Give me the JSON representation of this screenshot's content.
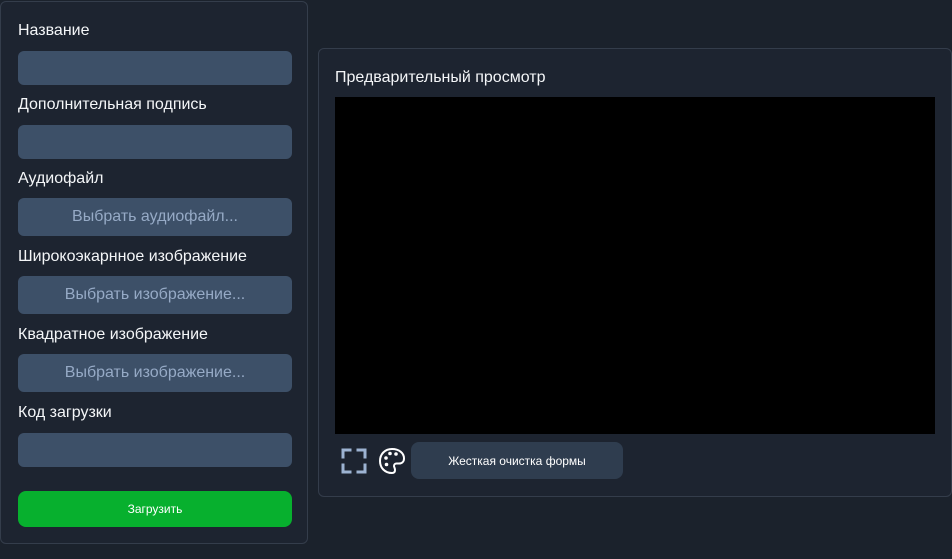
{
  "form": {
    "title_label": "Название",
    "title_value": "",
    "subtitle_label": "Дополнительная подпись",
    "subtitle_value": "",
    "audio_label": "Аудиофайл",
    "audio_button": "Выбрать аудиофайл...",
    "wide_image_label": "Широкоэкарнное изображение",
    "wide_image_button": "Выбрать изображение...",
    "square_image_label": "Квадратное изображение",
    "square_image_button": "Выбрать изображение...",
    "upload_code_label": "Код загрузки",
    "upload_code_value": "",
    "upload_button": "Загрузить"
  },
  "preview": {
    "title": "Предварительный просмотр",
    "clear_button": "Жесткая очистка формы"
  },
  "icons": {
    "fullscreen": "fullscreen-icon",
    "palette": "palette-icon"
  },
  "colors": {
    "background": "#1b222c",
    "panel": "#1d2430",
    "input": "#3d5068",
    "upload": "#07b02e",
    "preview": "#000000",
    "icon_accent": "#9db3d2"
  }
}
